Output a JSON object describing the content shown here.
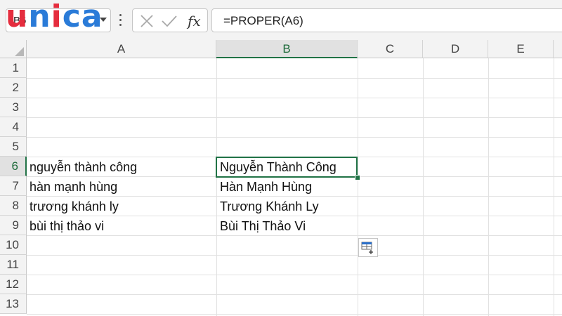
{
  "formula_bar": {
    "name_box": "B6",
    "formula": "=PROPER(A6)"
  },
  "logo": {
    "letters": [
      "u",
      "n",
      "i",
      "c",
      "a"
    ]
  },
  "columns": [
    "A",
    "B",
    "C",
    "D",
    "E"
  ],
  "selected_column": "B",
  "rows": [
    "1",
    "2",
    "3",
    "4",
    "5",
    "6",
    "7",
    "8",
    "9",
    "10",
    "11",
    "12",
    "13"
  ],
  "selected_row": "6",
  "cells": {
    "A6": "nguyễn thành công",
    "A7": "hàn mạnh hùng",
    "A8": "trương khánh ly",
    "A9": "bùi thị thảo vi",
    "B6": "Nguyễn Thành Công",
    "B7": "Hàn Mạnh Hùng",
    "B8": "Trương Khánh Ly",
    "B9": "Bùi Thị Thảo Vi"
  },
  "icons": {
    "cancel": "close-icon",
    "enter": "check-icon",
    "function": "fx-icon",
    "paste_options": "paste-options-icon"
  },
  "colors": {
    "selection": "#217346",
    "logo_red": "#e52d3e",
    "logo_blue": "#2a7bd8"
  }
}
